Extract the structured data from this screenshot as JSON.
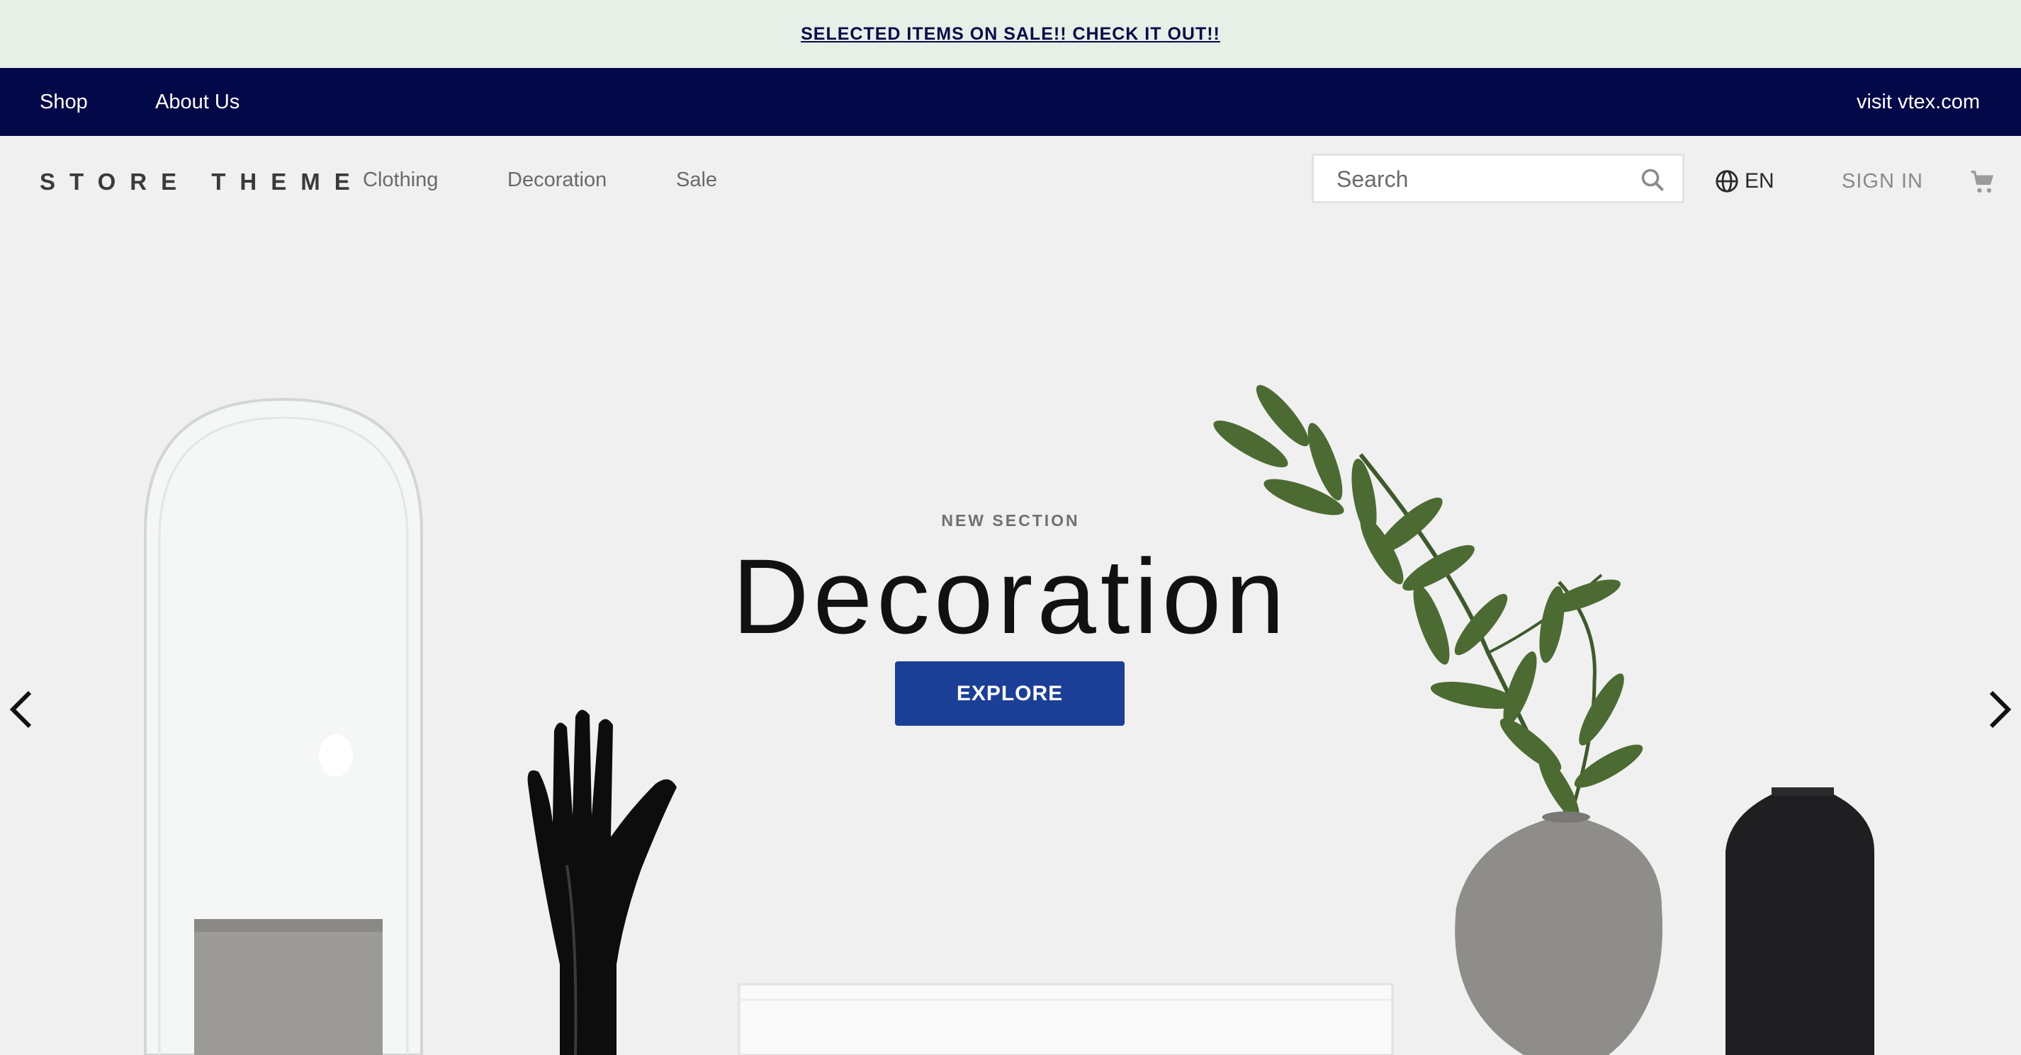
{
  "promo": {
    "text": "SELECTED ITEMS ON SALE!! CHECK IT OUT!!"
  },
  "top_nav": {
    "items": [
      {
        "label": "Shop"
      },
      {
        "label": "About Us"
      }
    ],
    "external_link": "visit vtex.com"
  },
  "header": {
    "logo": "STORE THEME",
    "categories": [
      {
        "label": "Clothing"
      },
      {
        "label": "Decoration"
      },
      {
        "label": "Sale"
      }
    ],
    "search": {
      "placeholder": "Search",
      "value": "",
      "icon": "search-icon"
    },
    "language": {
      "label": "EN",
      "icon": "globe-icon"
    },
    "sign_in": "SIGN IN",
    "cart": {
      "icon": "cart-icon"
    }
  },
  "hero": {
    "eyebrow": "NEW SECTION",
    "headline": "Decoration",
    "cta": "EXPLORE",
    "prev_icon": "chevron-left-icon",
    "next_icon": "chevron-right-icon"
  },
  "colors": {
    "promo_bg": "#e6f0e6",
    "nav_bg": "#030849",
    "cta_bg": "#1b3f96",
    "page_bg": "#f0f0f0"
  }
}
